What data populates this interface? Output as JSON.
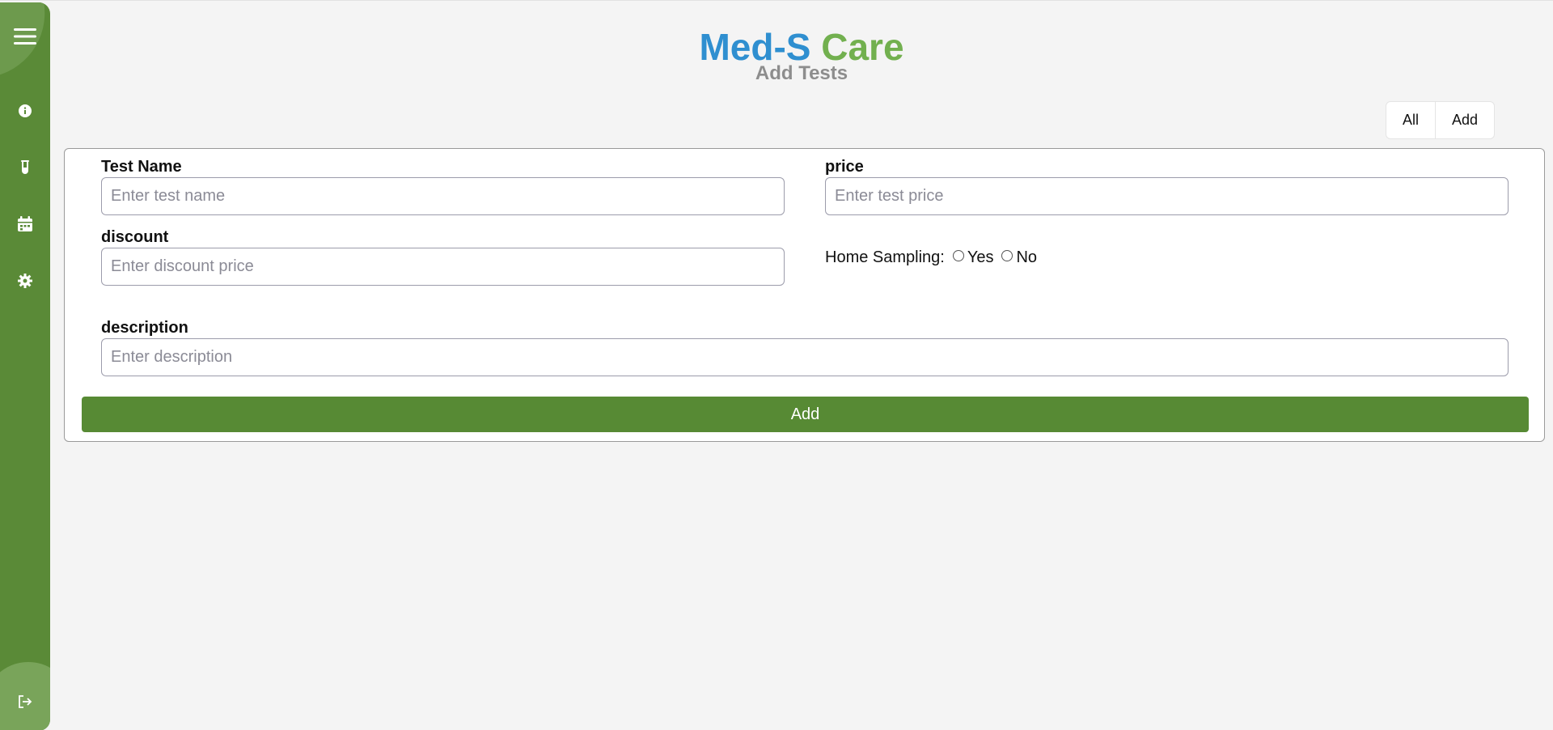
{
  "brand": {
    "part1": "Med-S",
    "part2": "Care"
  },
  "page": {
    "subtitle": "Add Tests"
  },
  "toggle": {
    "all_label": "All",
    "add_label": "Add"
  },
  "sidebar": {
    "icons": [
      "menu-icon",
      "info-icon",
      "test-tube-icon",
      "calendar-icon",
      "gear-icon",
      "logout-icon"
    ]
  },
  "form": {
    "test_name": {
      "label": "Test Name",
      "placeholder": "Enter test name",
      "value": ""
    },
    "price": {
      "label": "price",
      "placeholder": "Enter test price",
      "value": ""
    },
    "discount": {
      "label": "discount",
      "placeholder": "Enter discount price",
      "value": ""
    },
    "home_sampling": {
      "label": "Home Sampling:",
      "yes": "Yes",
      "no": "No"
    },
    "description": {
      "label": "description",
      "placeholder": "Enter description",
      "value": ""
    },
    "submit_label": "Add"
  },
  "colors": {
    "sidebar": "#5a8a37",
    "brand_blue": "#2f8fd0",
    "brand_green": "#72b04f",
    "button": "#578a34"
  }
}
